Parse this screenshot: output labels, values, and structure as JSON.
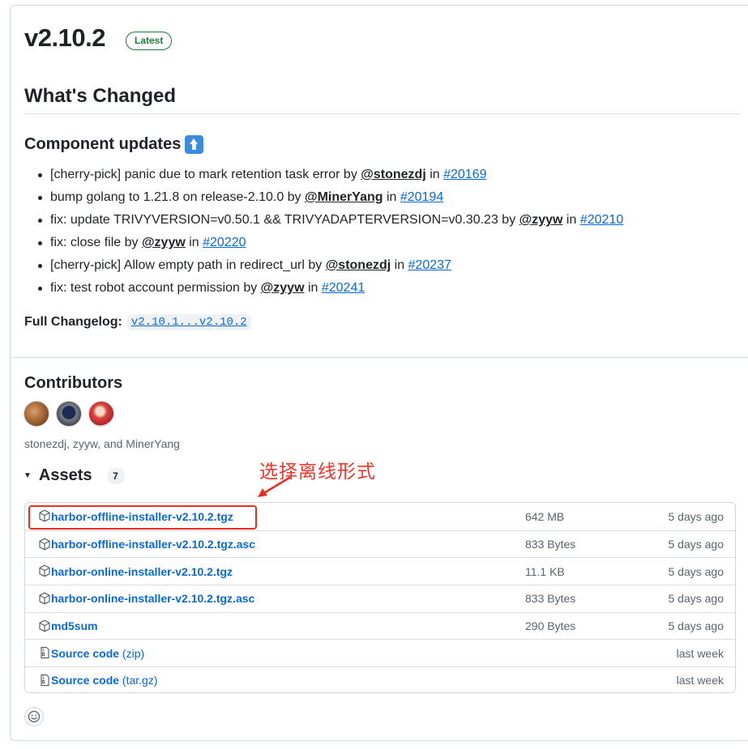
{
  "release": {
    "version": "v2.10.2",
    "badge": "Latest"
  },
  "whats_changed": {
    "title": "What's Changed",
    "subtitle": "Component updates",
    "subtitle_icon": "up-arrow-emoji-icon",
    "items": [
      {
        "text": "[cherry-pick] panic due to mark retention task error by ",
        "user": "@stonezdj",
        "in": " in ",
        "pr": "#20169"
      },
      {
        "text": "bump golang to 1.21.8 on release-2.10.0 by ",
        "user": "@MinerYang",
        "in": " in ",
        "pr": "#20194"
      },
      {
        "text": "fix: update TRIVYVERSION=v0.50.1 && TRIVYADAPTERVERSION=v0.30.23 by ",
        "user": "@zyyw",
        "in": " in ",
        "pr": "#20210"
      },
      {
        "text": "fix: close file by ",
        "user": "@zyyw",
        "in": " in ",
        "pr": "#20220"
      },
      {
        "text": "[cherry-pick] Allow empty path in redirect_url by ",
        "user": "@stonezdj",
        "in": " in ",
        "pr": "#20237"
      },
      {
        "text": "fix: test robot account permission by ",
        "user": "@zyyw",
        "in": " in ",
        "pr": "#20241"
      }
    ],
    "full_changelog_label": "Full Changelog:",
    "full_changelog_link": "v2.10.1...v2.10.2"
  },
  "contributors": {
    "title": "Contributors",
    "names": "stonezdj, zyyw, and MinerYang"
  },
  "annotation": {
    "text": "选择离线形式",
    "color": "#f5322a"
  },
  "assets": {
    "title": "Assets",
    "count": "7",
    "rows": [
      {
        "icon": "package-icon",
        "name": "harbor-offline-installer-v2.10.2.tgz",
        "suffix": "",
        "size": "642 MB",
        "date": "5 days ago"
      },
      {
        "icon": "package-icon",
        "name": "harbor-offline-installer-v2.10.2.tgz.asc",
        "suffix": "",
        "size": "833 Bytes",
        "date": "5 days ago"
      },
      {
        "icon": "package-icon",
        "name": "harbor-online-installer-v2.10.2.tgz",
        "suffix": "",
        "size": "11.1 KB",
        "date": "5 days ago"
      },
      {
        "icon": "package-icon",
        "name": "harbor-online-installer-v2.10.2.tgz.asc",
        "suffix": "",
        "size": "833 Bytes",
        "date": "5 days ago"
      },
      {
        "icon": "package-icon",
        "name": "md5sum",
        "suffix": "",
        "size": "290 Bytes",
        "date": "5 days ago"
      },
      {
        "icon": "file-zip-icon",
        "name": "Source code",
        "suffix": " (zip)",
        "size": "",
        "date": "last week"
      },
      {
        "icon": "file-zip-icon",
        "name": "Source code",
        "suffix": " (tar.gz)",
        "size": "",
        "date": "last week"
      }
    ]
  },
  "colors": {
    "link": "#0969da",
    "latest_green": "#1a7f37",
    "highlight_red": "#ec2d20"
  }
}
